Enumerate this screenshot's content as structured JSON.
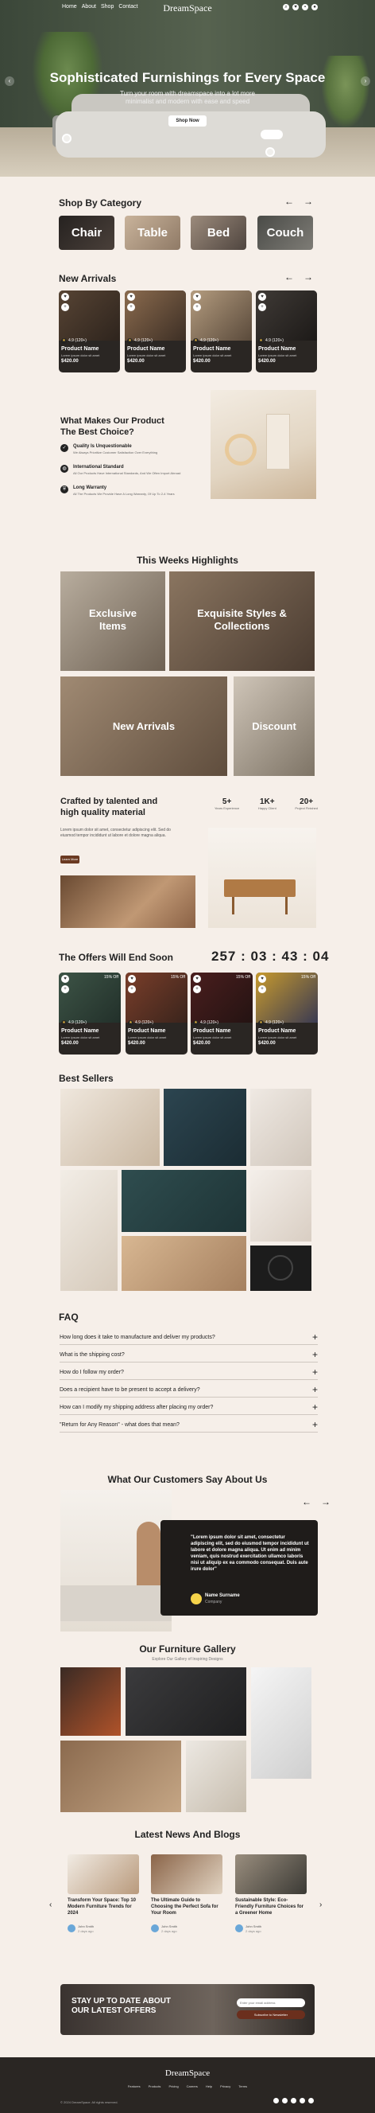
{
  "nav": {
    "links": [
      "Home",
      "About",
      "Shop",
      "Contact"
    ],
    "logo": "DreamSpace"
  },
  "hero": {
    "title": "Sophisticated Furnishings for Every Space",
    "subtitle": "Turn your room with dreamspace into a lot more minimalist and modern with ease and speed",
    "button": "Shop Now"
  },
  "categories": {
    "title": "Shop By Category",
    "items": [
      "Chair",
      "Table",
      "Bed",
      "Couch"
    ]
  },
  "new_arrivals": {
    "title": "New Arrivals",
    "cards": [
      {
        "rating": "4.9 (120+)",
        "name": "Product Name",
        "desc": "Lorem ipsum dolor sit amet",
        "price": "$420.00"
      },
      {
        "rating": "4.9 (120+)",
        "name": "Product Name",
        "desc": "Lorem ipsum dolor sit amet",
        "price": "$420.00"
      },
      {
        "rating": "4.9 (120+)",
        "name": "Product Name",
        "desc": "Lorem ipsum dolor sit amet",
        "price": "$420.00"
      },
      {
        "rating": "4.9 (120+)",
        "name": "Product Name",
        "desc": "Lorem ipsum dolor sit amet",
        "price": "$420.00"
      }
    ]
  },
  "why": {
    "title": "What Makes Our Product The Best Choice?",
    "items": [
      {
        "title": "Quality Is Unquestionable",
        "desc": "We Always Prioritize Customer Satisfaction Over Everything"
      },
      {
        "title": "International Standard",
        "desc": "All Our Products Have International Standards, And We Often Import Abroad"
      },
      {
        "title": "Long Warranty",
        "desc": "All The Products We Provide Have A Long Warranty, Of Up To 2-4 Years"
      }
    ]
  },
  "highlights": {
    "title": "This Weeks Highlights",
    "items": [
      "Exclusive Items",
      "Exquisite Styles & Collections",
      "New Arrivals",
      "Discount"
    ]
  },
  "crafted": {
    "title": "Crafted by talented and high quality material",
    "desc": "Lorem ipsum dolor sit amet, consectetur adipiscing elit. Sed do eiusmod tempor incididunt ut labore et dolore magna aliqua.",
    "button": "Learn More",
    "stats": [
      {
        "value": "5+",
        "label": "Years Experience"
      },
      {
        "value": "1K+",
        "label": "Happy Client"
      },
      {
        "value": "20+",
        "label": "Project Finished"
      }
    ]
  },
  "offers": {
    "title": "The Offers Will End Soon",
    "timer": [
      "257",
      "03",
      "43",
      "04"
    ],
    "cards": [
      {
        "discount": "15% Off",
        "rating": "4.9 (120+)",
        "name": "Product Name",
        "desc": "Lorem ipsum dolor sit amet",
        "price": "$420.00"
      },
      {
        "discount": "15% Off",
        "rating": "4.9 (120+)",
        "name": "Product Name",
        "desc": "Lorem ipsum dolor sit amet",
        "price": "$420.00"
      },
      {
        "discount": "15% Off",
        "rating": "4.9 (120+)",
        "name": "Product Name",
        "desc": "Lorem ipsum dolor sit amet",
        "price": "$420.00"
      },
      {
        "discount": "15% Off",
        "rating": "4.9 (120+)",
        "name": "Product Name",
        "desc": "Lorem ipsum dolor sit amet",
        "price": "$420.00"
      }
    ]
  },
  "best_sellers": {
    "title": "Best Sellers"
  },
  "faq": {
    "title": "FAQ",
    "items": [
      "How long does it take to manufacture and deliver my products?",
      "What is the shipping cost?",
      "How do I follow my order?",
      "Does a recipient have to be present to accept a delivery?",
      "How can I modify my shipping address after placing my order?",
      "\"Return for Any Reason\" - what does that mean?"
    ]
  },
  "testimonials": {
    "title": "What Our Customers Say About Us",
    "quote": "\"Lorem ipsum dolor sit amet, consectetur adipiscing elit, sed do eiusmod tempor incididunt ut labore et dolore magna aliqua. Ut enim ad minim veniam, quis nostrud exercitation ullamco laboris nisi ut aliquip ex ea commodo consequat. Duis aute irure dolor\"",
    "name": "Name Surname",
    "role": "Company"
  },
  "gallery": {
    "title": "Our Furniture Gallery",
    "subtitle": "Explore Our Gallery of Inspiring Designs"
  },
  "blog": {
    "title": "Latest News And Blogs",
    "items": [
      {
        "title": "Transform Your Space: Top 10 Modern Furniture Trends for 2024",
        "author": "John Smith",
        "date": "2 days ago"
      },
      {
        "title": "The Ultimate Guide to Choosing the Perfect Sofa for Your Room",
        "author": "John Smith",
        "date": "2 days ago"
      },
      {
        "title": "Sustainable Style: Eco-Friendly Furniture Choices for a Greener Home",
        "author": "John Smith",
        "date": "2 days ago"
      }
    ]
  },
  "newsletter": {
    "title": "STAY UP TO DATE ABOUT OUR LATEST OFFERS",
    "placeholder": "Enter your email address",
    "button": "Subscribe to Newsletter"
  },
  "footer": {
    "logo": "DreamSpace",
    "links": [
      "Features",
      "Products",
      "Pricing",
      "Careers",
      "Help",
      "Privacy",
      "Terms"
    ],
    "copyright": "© 2024 DreamSpace. All rights reserved."
  }
}
